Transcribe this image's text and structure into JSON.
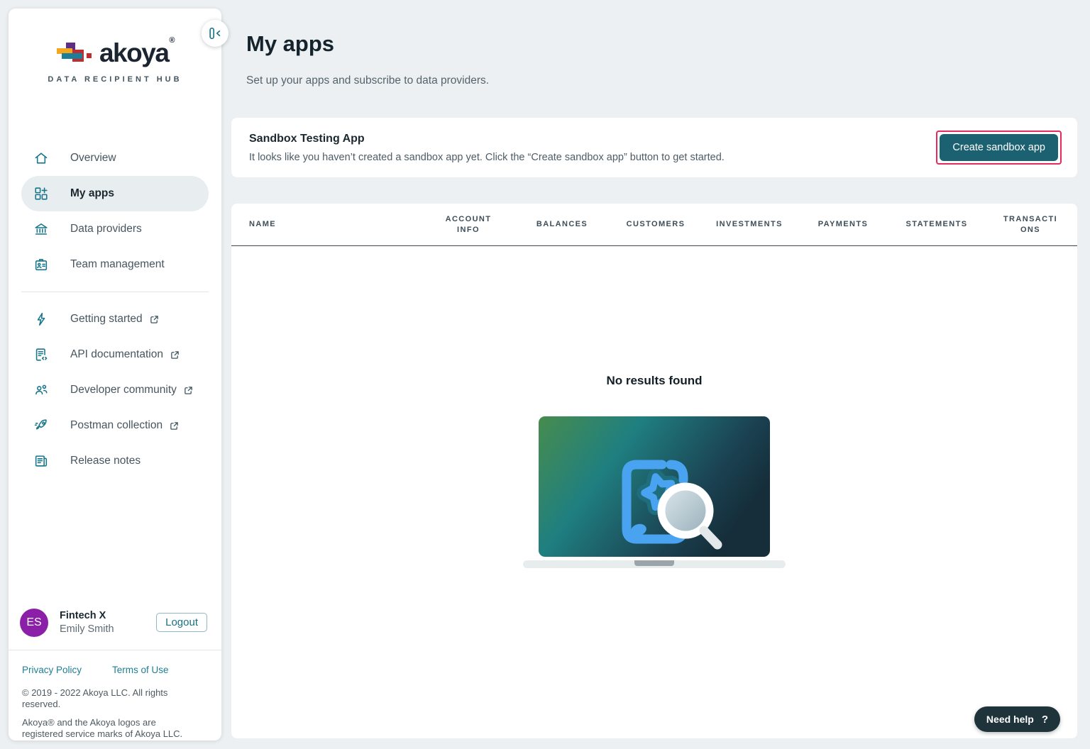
{
  "brand": {
    "wordmark": "akoya",
    "registered": "®",
    "tagline": "DATA RECIPIENT HUB"
  },
  "sidebar": {
    "nav": [
      {
        "label": "Overview",
        "icon": "home-icon",
        "active": false
      },
      {
        "label": "My apps",
        "icon": "apps-icon",
        "active": true
      },
      {
        "label": "Data providers",
        "icon": "bank-icon",
        "active": false
      },
      {
        "label": "Team management",
        "icon": "badge-icon",
        "active": false
      }
    ],
    "links": [
      {
        "label": "Getting started",
        "icon": "bolt-icon",
        "external": true
      },
      {
        "label": "API documentation",
        "icon": "api-doc-icon",
        "external": true
      },
      {
        "label": "Developer community",
        "icon": "community-icon",
        "external": true
      },
      {
        "label": "Postman collection",
        "icon": "rocket-icon",
        "external": true
      },
      {
        "label": "Release notes",
        "icon": "notes-icon",
        "external": false
      }
    ],
    "user": {
      "initials": "ES",
      "org": "Fintech X",
      "name": "Emily Smith",
      "logout_label": "Logout"
    },
    "footer": {
      "privacy_label": "Privacy Policy",
      "terms_label": "Terms of Use",
      "copyright": "© 2019 - 2022 Akoya LLC. All rights reserved.",
      "trademark": "Akoya® and the Akoya logos are registered service marks of Akoya LLC."
    }
  },
  "main": {
    "title": "My apps",
    "subtitle": "Set up your apps and subscribe to data providers.",
    "sandbox_card": {
      "title": "Sandbox Testing App",
      "description": "It looks like you haven’t created a sandbox app yet. Click the “Create sandbox app” button to get started.",
      "button_label": "Create sandbox app"
    },
    "table": {
      "columns": [
        "NAME",
        "ACCOUNT INFO",
        "BALANCES",
        "CUSTOMERS",
        "INVESTMENTS",
        "PAYMENTS",
        "STATEMENTS",
        "TRANSACTIONS"
      ]
    },
    "empty_state": {
      "title": "No results found"
    },
    "help": {
      "label": "Need help",
      "icon_glyph": "?"
    }
  },
  "colors": {
    "accent_teal": "#17768b",
    "button_teal": "#1c6172",
    "highlight_ring_pink": "#e42a5e",
    "avatar_purple": "#8b1fa8",
    "page_background": "#ecf0f2",
    "logo_yellow": "#f2a71f",
    "logo_purple": "#5e2d84",
    "logo_teal": "#1d7f97",
    "logo_red": "#bf2c31",
    "illustration_blue": "#4aa3f0",
    "need_help_bg": "#1f333b"
  }
}
